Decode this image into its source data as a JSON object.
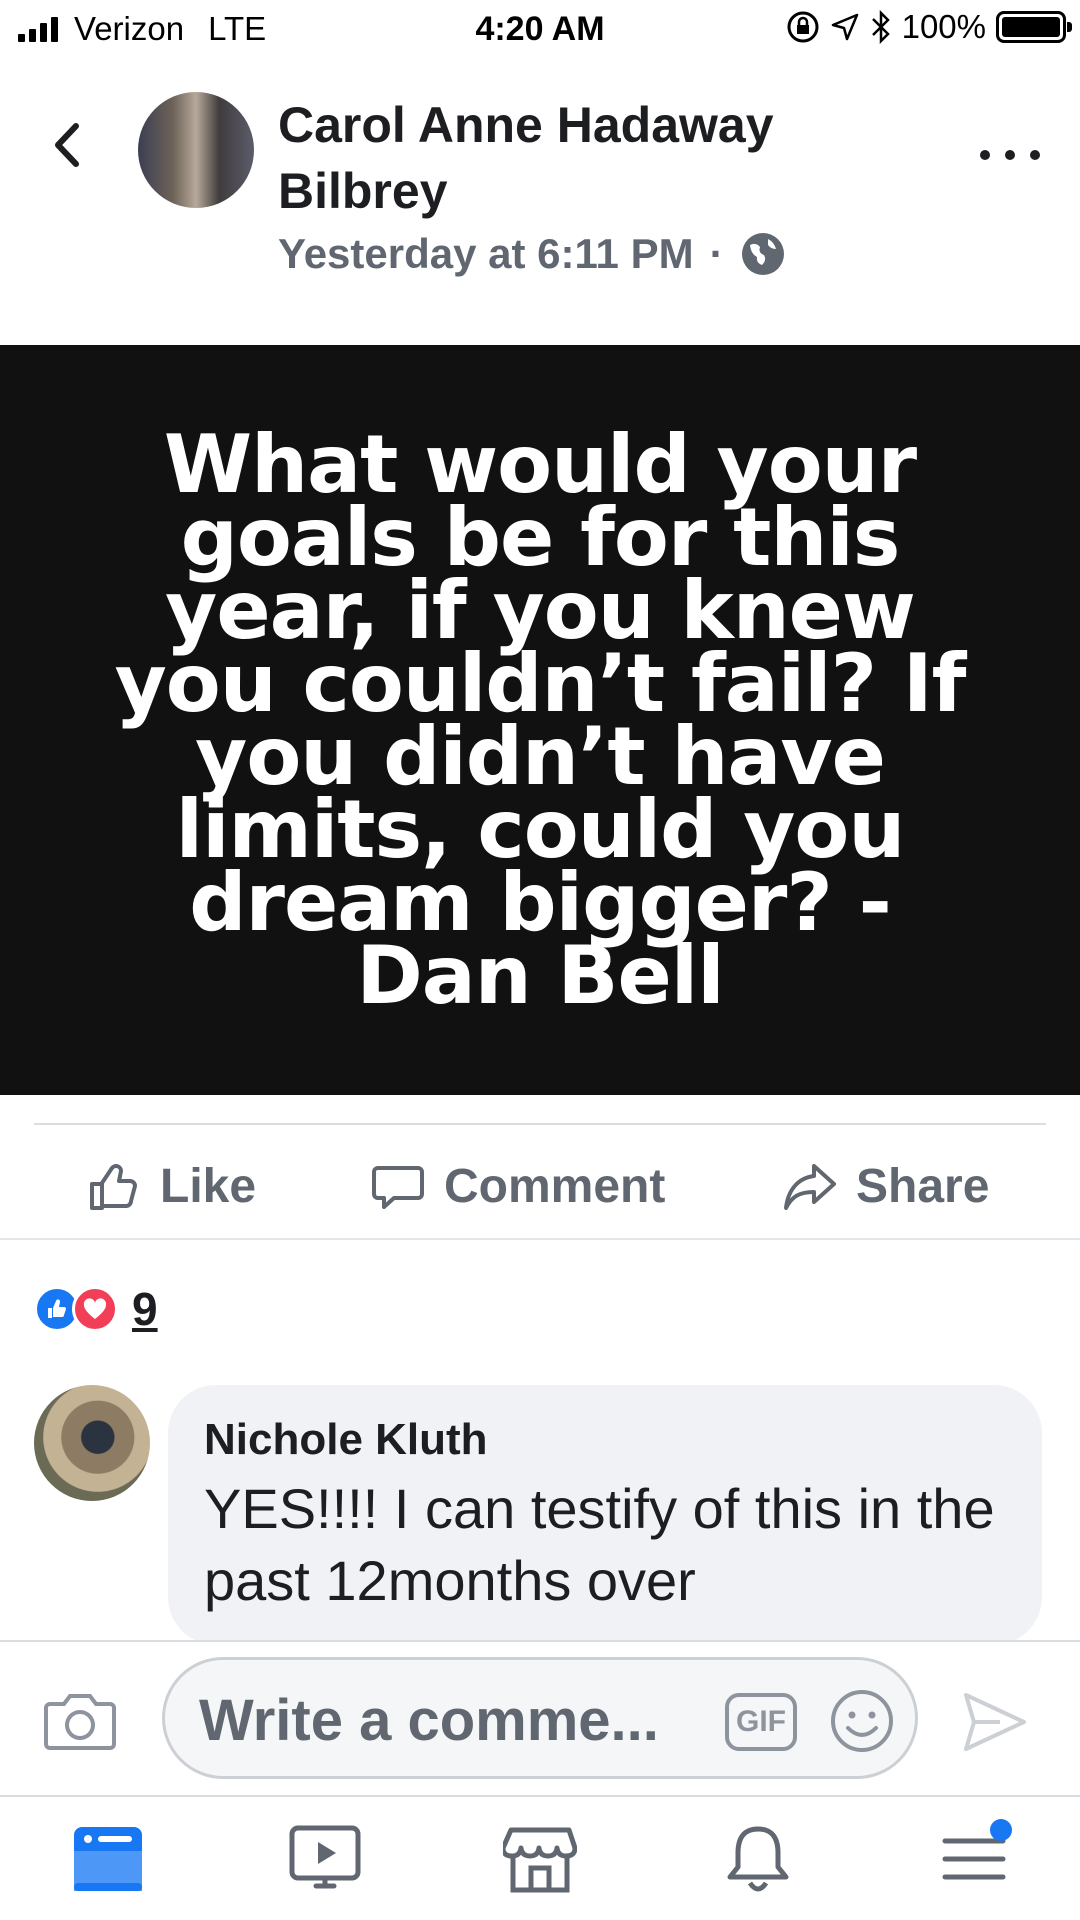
{
  "status_bar": {
    "carrier": "Verizon",
    "network": "LTE",
    "time": "4:20 AM",
    "battery": "100%",
    "battery_level": 1.0
  },
  "post": {
    "author": "Carol Anne Hadaway Bilbrey",
    "timestamp": "Yesterday at 6:11 PM",
    "separator": "·",
    "privacy_icon": "globe-icon",
    "quote": "What would your goals be for this year, if you knew you couldn’t fail? If you didn’t have limits, could you dream bigger? - Dan Bell",
    "quote_bg": "#111111"
  },
  "actions": {
    "like": "Like",
    "comment": "Comment",
    "share": "Share"
  },
  "reactions": {
    "count": "9",
    "types": [
      "like",
      "love"
    ]
  },
  "comment": {
    "author": "Nichole Kluth",
    "text": "YES!!!! I can testify of this in the past 12months over"
  },
  "composer": {
    "placeholder": "Write a comme...",
    "gif_label": "GIF"
  },
  "nav": {
    "items": [
      "news-feed",
      "watch",
      "marketplace",
      "notifications",
      "menu"
    ],
    "active": "news-feed",
    "accent": "#1877f2"
  }
}
